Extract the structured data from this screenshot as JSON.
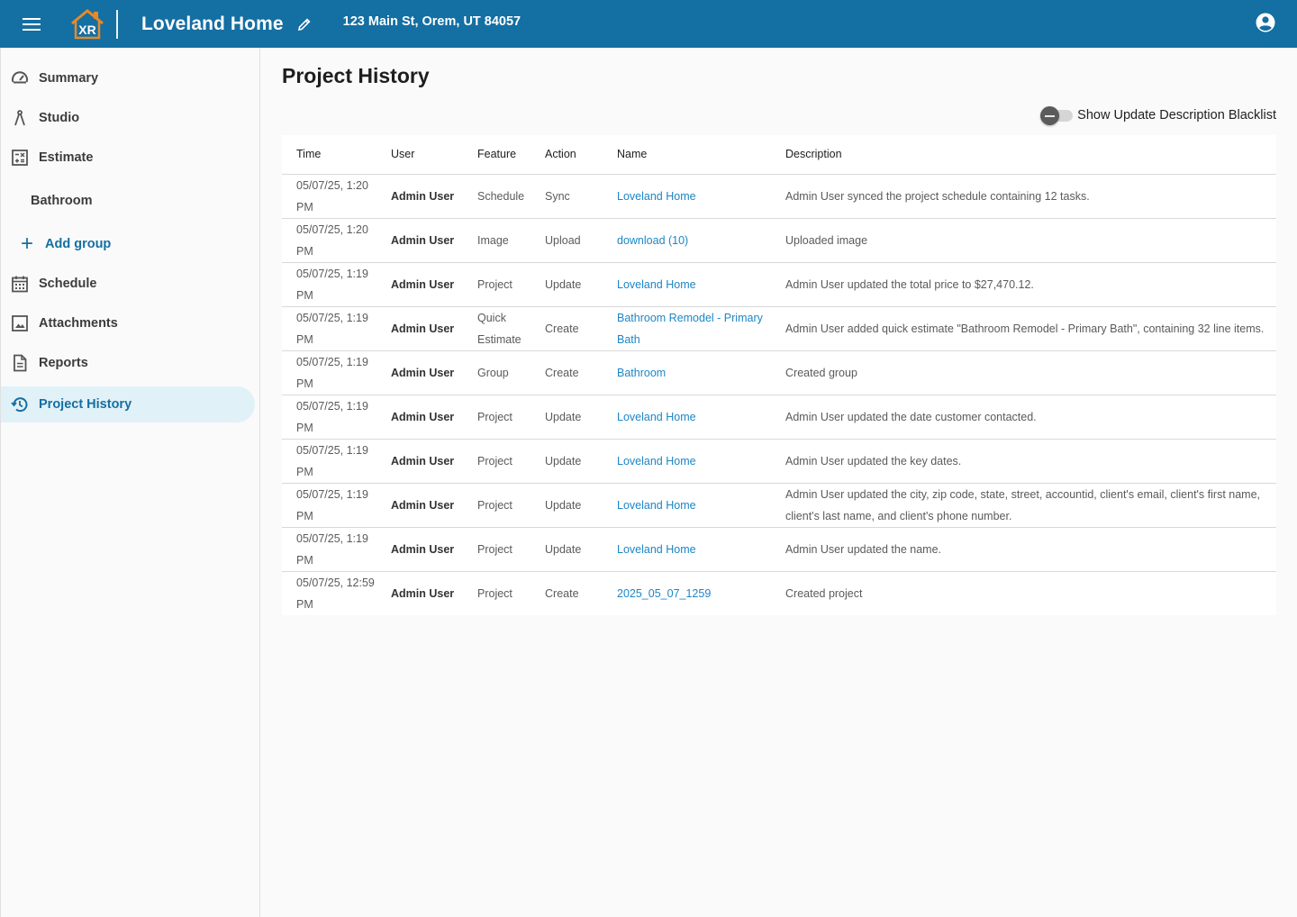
{
  "header": {
    "logo_text": "XR",
    "project_title": "Loveland Home",
    "address": "123 Main St, Orem, UT 84057",
    "brand_color": "#146fa2"
  },
  "sidebar": {
    "items": [
      {
        "label": "Summary",
        "icon": "speedometer-icon"
      },
      {
        "label": "Studio",
        "icon": "compass-icon"
      },
      {
        "label": "Estimate",
        "icon": "calculator-icon"
      },
      {
        "label": "Schedule",
        "icon": "calendar-icon"
      },
      {
        "label": "Attachments",
        "icon": "image-icon"
      },
      {
        "label": "Reports",
        "icon": "document-icon"
      },
      {
        "label": "Project History",
        "icon": "history-icon",
        "active": true
      }
    ],
    "estimate_groups": [
      "Bathroom"
    ],
    "add_group_label": "Add group"
  },
  "main": {
    "title": "Project History",
    "toggle_label": "Show Update Description Blacklist",
    "table": {
      "columns": [
        "Time",
        "User",
        "Feature",
        "Action",
        "Name",
        "Description"
      ],
      "rows": [
        {
          "time": "05/07/25, 1:20 PM",
          "user": "Admin User",
          "feature": "Schedule",
          "action": "Sync",
          "name": "Loveland Home",
          "description": "Admin User synced the project schedule containing 12 tasks."
        },
        {
          "time": "05/07/25, 1:20 PM",
          "user": "Admin User",
          "feature": "Image",
          "action": "Upload",
          "name": "download (10)",
          "description": "Uploaded image"
        },
        {
          "time": "05/07/25, 1:19 PM",
          "user": "Admin User",
          "feature": "Project",
          "action": "Update",
          "name": "Loveland Home",
          "description": "Admin User updated the total price to $27,470.12."
        },
        {
          "time": "05/07/25, 1:19 PM",
          "user": "Admin User",
          "feature": "Quick Estimate",
          "action": "Create",
          "name": "Bathroom Remodel - Primary Bath",
          "description": "Admin User added quick estimate \"Bathroom Remodel - Primary Bath\", containing 32 line items."
        },
        {
          "time": "05/07/25, 1:19 PM",
          "user": "Admin User",
          "feature": "Group",
          "action": "Create",
          "name": "Bathroom",
          "description": "Created group"
        },
        {
          "time": "05/07/25, 1:19 PM",
          "user": "Admin User",
          "feature": "Project",
          "action": "Update",
          "name": "Loveland Home",
          "description": "Admin User updated the date customer contacted."
        },
        {
          "time": "05/07/25, 1:19 PM",
          "user": "Admin User",
          "feature": "Project",
          "action": "Update",
          "name": "Loveland Home",
          "description": "Admin User updated the key dates."
        },
        {
          "time": "05/07/25, 1:19 PM",
          "user": "Admin User",
          "feature": "Project",
          "action": "Update",
          "name": "Loveland Home",
          "description": "Admin User updated the city, zip code, state, street, accountid, client's email, client's first name, client's last name, and client's phone number."
        },
        {
          "time": "05/07/25, 1:19 PM",
          "user": "Admin User",
          "feature": "Project",
          "action": "Update",
          "name": "Loveland Home",
          "description": "Admin User updated the name."
        },
        {
          "time": "05/07/25, 12:59 PM",
          "user": "Admin User",
          "feature": "Project",
          "action": "Create",
          "name": "2025_05_07_1259",
          "description": "Created project"
        }
      ]
    }
  }
}
